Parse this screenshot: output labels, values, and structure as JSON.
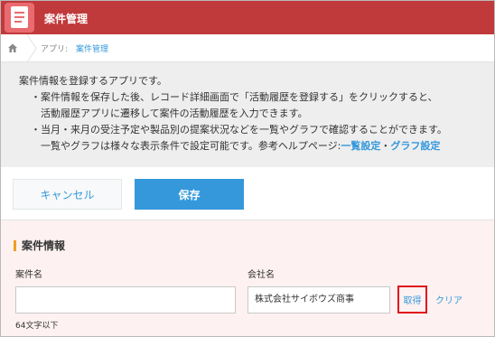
{
  "app": {
    "title": "案件管理"
  },
  "breadcrumb": {
    "prefix": "アプリ:",
    "link": "案件管理"
  },
  "description": {
    "line1": "案件情報を登録するアプリです。",
    "line2": "・案件情報を保存した後、レコード詳細画面で「活動履歴を登録する」をクリックすると、",
    "line3": "活動履歴アプリに遷移して案件の活動履歴を入力できます。",
    "line4": "・当月・来月の受注予定や製品別の提案状況などを一覧やグラフで確認することができます。",
    "line5_text": "一覧やグラフは様々な表示条件で設定可能です。参考ヘルプページ:",
    "line5_link1": "一覧設定",
    "line5_sep": "・",
    "line5_link2": "グラフ設定"
  },
  "actions": {
    "cancel_label": "キャンセル",
    "save_label": "保存"
  },
  "form": {
    "section_title": "案件情報",
    "project_name": {
      "label": "案件名",
      "value": "",
      "hint": "64文字以下"
    },
    "company_name": {
      "label": "会社名",
      "value": "株式会社サイボウズ商事"
    },
    "get_label": "取得",
    "clear_label": "クリア"
  },
  "colors": {
    "header": "#c0393b",
    "accent": "#3498db",
    "form_background": "#fdf1f1",
    "section_marker": "#f0a020",
    "highlight_box": "#e0121c"
  },
  "icons": {
    "app": "document-icon",
    "home": "home-icon"
  }
}
